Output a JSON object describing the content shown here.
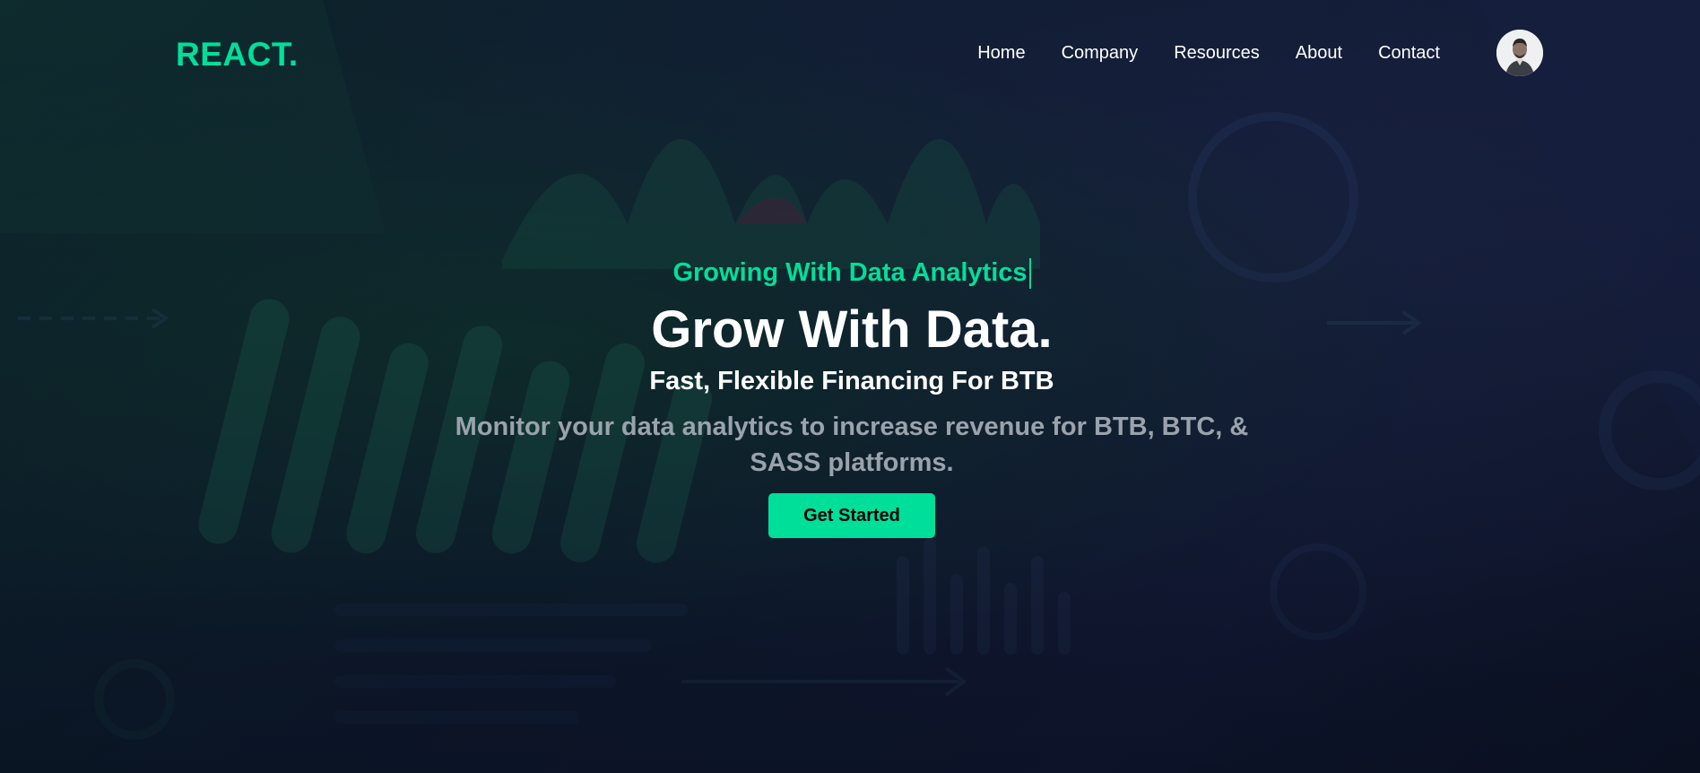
{
  "brand": {
    "logo_text": "REACT.",
    "accent_color": "#00df9a"
  },
  "nav": {
    "items": [
      {
        "label": "Home"
      },
      {
        "label": "Company"
      },
      {
        "label": "Resources"
      },
      {
        "label": "About"
      },
      {
        "label": "Contact"
      }
    ],
    "avatar_icon": "user-avatar-icon"
  },
  "hero": {
    "eyebrow": "Growing With Data Analytics",
    "headline": "Grow With Data.",
    "subheadline": "Fast, Flexible Financing For BTB",
    "description": "Monitor your data analytics to increase revenue for BTB, BTC, & SASS platforms.",
    "cta_label": "Get Started"
  }
}
